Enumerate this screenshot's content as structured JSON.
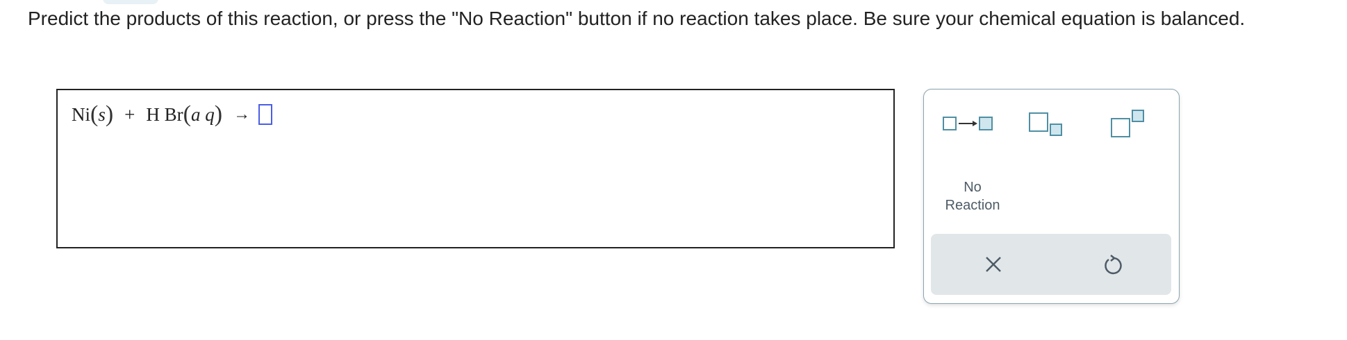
{
  "question": {
    "prompt": "Predict the products of this reaction, or press the \"No Reaction\" button if no reaction takes place. Be sure your chemical equation is balanced."
  },
  "equation": {
    "reactant1": {
      "formula": "Ni",
      "state": "s"
    },
    "plus": "+",
    "reactant2": {
      "formula": "H Br",
      "state": "a q"
    },
    "arrow": "→"
  },
  "toolbar": {
    "arrow_tool_icon": "box-arrow-box-icon",
    "subscript_tool_icon": "subscript-box-icon",
    "superscript_tool_icon": "superscript-box-icon",
    "no_reaction_line1": "No",
    "no_reaction_line2": "Reaction",
    "clear_icon": "x-icon",
    "undo_icon": "undo-icon"
  },
  "colors": {
    "accent": "#4a5ee6",
    "icon_stroke": "#4f8fa3",
    "icon_fill": "#cfe6ee",
    "panel_border": "#8aa3b0",
    "action_bar": "#e1e6e9"
  }
}
